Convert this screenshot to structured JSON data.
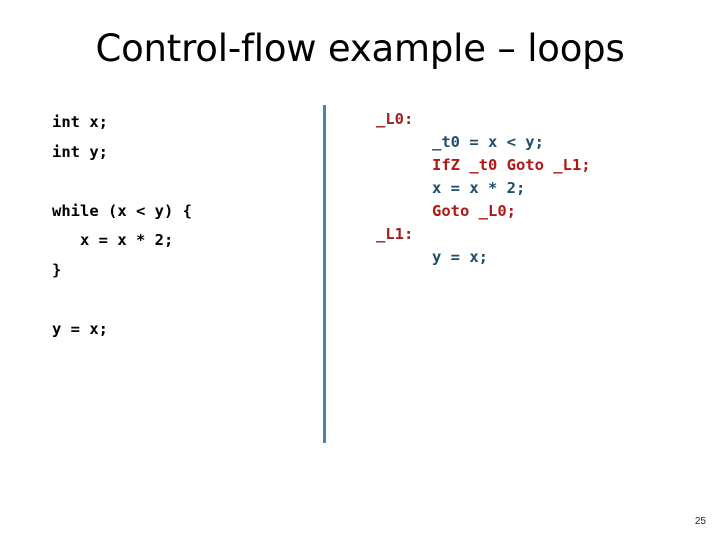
{
  "slide": {
    "title": "Control-flow example – loops",
    "page_number": "25",
    "background_color": "#ffffff"
  },
  "colors": {
    "title": "#000000",
    "source_code": "#000000",
    "divider": "#4F81AE",
    "ir_label": "#9E2020",
    "ir_assign": "#1F4E68",
    "ir_jump": "#B01818"
  },
  "source_panel": {
    "lines": [
      "int x;",
      "int y;",
      "",
      "while (x < y) {",
      "   x = x * 2;",
      "}",
      "",
      "y = x;"
    ]
  },
  "ir_panel": {
    "lines": [
      {
        "text": "_L0:",
        "kind": "label"
      },
      {
        "text": "      _t0 = x < y;",
        "kind": "assign"
      },
      {
        "text": "      IfZ _t0 Goto _L1;",
        "kind": "jump"
      },
      {
        "text": "      x = x * 2;",
        "kind": "assign"
      },
      {
        "text": "      Goto _L0;",
        "kind": "jump"
      },
      {
        "text": "_L1:",
        "kind": "label"
      },
      {
        "text": "      y = x;",
        "kind": "assign"
      }
    ]
  }
}
